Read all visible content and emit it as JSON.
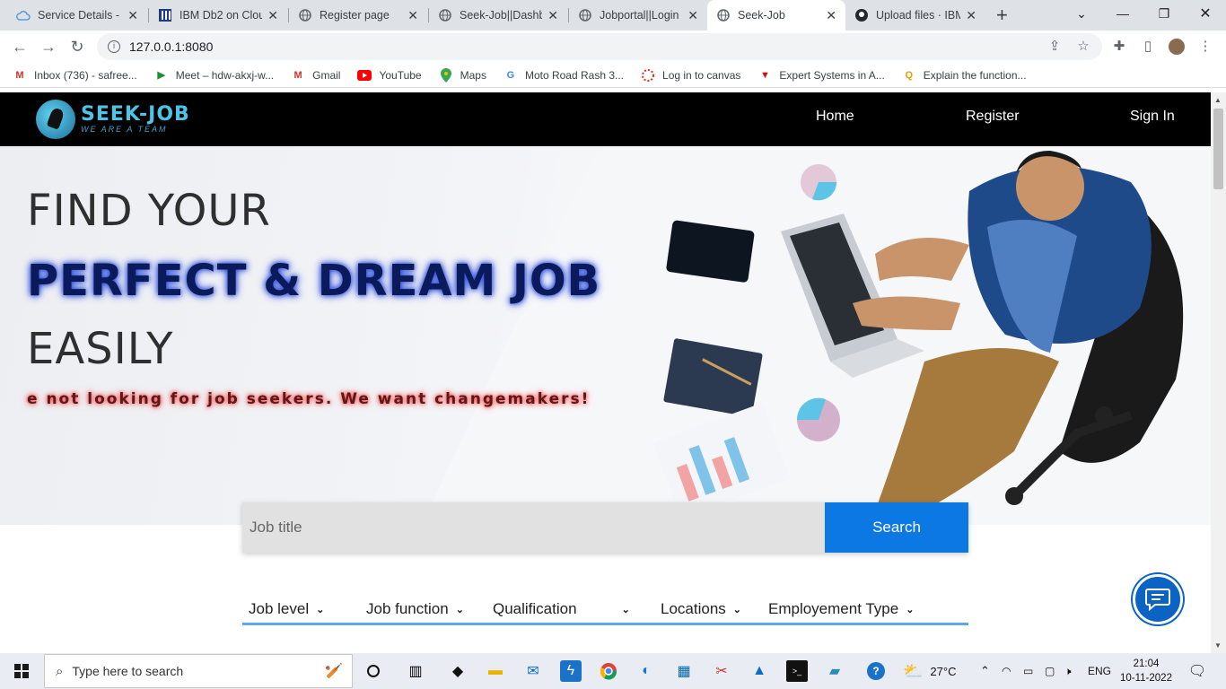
{
  "browser": {
    "tabs": [
      {
        "title": "Service Details - I",
        "icon": "cloud-icon",
        "active": false
      },
      {
        "title": "IBM Db2 on Clou",
        "icon": "grid-icon",
        "active": false
      },
      {
        "title": "Register page",
        "icon": "globe-icon",
        "active": false
      },
      {
        "title": "Seek-Job||Dashb",
        "icon": "globe-icon",
        "active": false
      },
      {
        "title": "Jobportal||Login",
        "icon": "globe-icon",
        "active": false
      },
      {
        "title": "Seek-Job",
        "icon": "globe-icon",
        "active": true
      },
      {
        "title": "Upload files · IBM",
        "icon": "github-icon",
        "active": false
      }
    ],
    "url": "127.0.0.1:8080",
    "bookmarks": [
      {
        "label": "Inbox (736) - safree...",
        "icon": "gmail-icon"
      },
      {
        "label": "Meet – hdw-akxj-w...",
        "icon": "meet-icon"
      },
      {
        "label": "Gmail",
        "icon": "gmail-icon"
      },
      {
        "label": "YouTube",
        "icon": "youtube-icon"
      },
      {
        "label": "Maps",
        "icon": "maps-icon"
      },
      {
        "label": "Moto Road Rash 3...",
        "icon": "g-icon"
      },
      {
        "label": "Log in to canvas",
        "icon": "canvas-icon"
      },
      {
        "label": "Expert Systems in A...",
        "icon": "triangle-icon"
      },
      {
        "label": "Explain the function...",
        "icon": "q-icon"
      }
    ]
  },
  "site": {
    "brand": "SEEK-JOB",
    "tagline": "WE ARE A TEAM",
    "nav": {
      "home": "Home",
      "register": "Register",
      "signin": "Sign In"
    },
    "hero": {
      "line1": "FIND YOUR",
      "line2": "PERFECT & DREAM JOB",
      "line3": "EASILY",
      "tagline": "e not looking for job seekers. We want changemakers!"
    },
    "search": {
      "placeholder": "Job title",
      "button": "Search"
    },
    "filters": [
      "Job level",
      "Job function",
      "Qualification",
      "Locations",
      "Employement Type"
    ]
  },
  "taskbar": {
    "search_placeholder": "Type here to search",
    "weather": "27°C",
    "language": "ENG",
    "time": "21:04",
    "date": "10-11-2022"
  },
  "colors": {
    "accent": "#0b78e3",
    "nav_bg": "#000000",
    "brand": "#4cc4e8"
  }
}
